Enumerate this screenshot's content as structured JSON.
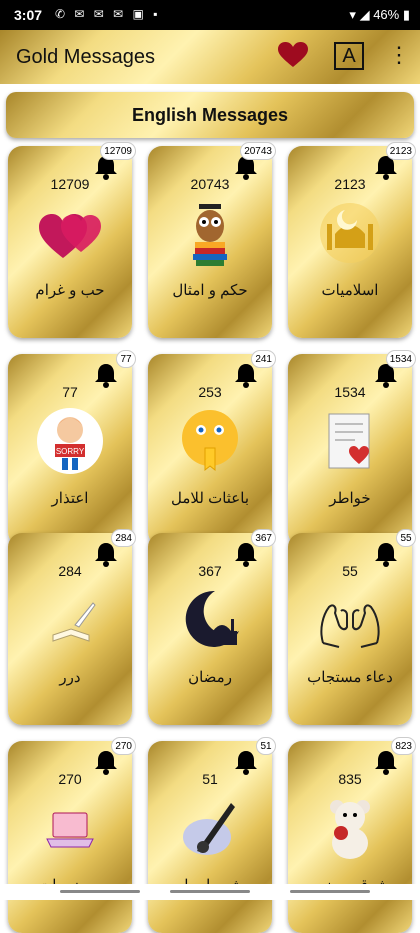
{
  "status_bar": {
    "time": "3:07",
    "battery": "46%",
    "left_icons": "✆ ✉ ✉ ✉ ▣ ▪"
  },
  "app_bar": {
    "title": "Gold Messages",
    "font_button": "A",
    "menu": "⋮"
  },
  "english_button": "English Messages",
  "colors": {
    "gold_light": "#fff2b0",
    "gold_dark": "#a8862a",
    "heart": "#9e0b1f"
  },
  "cards": [
    {
      "label": "حب و غرام",
      "count": "12709",
      "badge": "12709",
      "icon": "two-hearts-icon"
    },
    {
      "label": "حكم و امثال",
      "count": "20743",
      "badge": "20743",
      "icon": "owl-books-icon"
    },
    {
      "label": "اسلاميات",
      "count": "2123",
      "badge": "2123",
      "icon": "mosque-icon"
    },
    {
      "label": "اعتذار",
      "count": "77",
      "badge": "77",
      "icon": "sorry-boy-icon"
    },
    {
      "label": "باعثات للامل",
      "count": "253",
      "badge": "241",
      "icon": "praying-emoji-icon"
    },
    {
      "label": "خواطر",
      "count": "1534",
      "badge": "1534",
      "icon": "letter-heart-icon"
    },
    {
      "label": "درر",
      "count": "284",
      "badge": "284",
      "icon": "book-quill-icon"
    },
    {
      "label": "رمضان",
      "count": "367",
      "badge": "367",
      "icon": "crescent-moon-icon"
    },
    {
      "label": "دعاء مستجاب",
      "count": "55",
      "badge": "55",
      "icon": "praying-hands-icon"
    },
    {
      "label": "رومنسيات",
      "count": "270",
      "badge": "270",
      "icon": "laptop-icon"
    },
    {
      "label": "شعر اصيل",
      "count": "51",
      "badge": "51",
      "icon": "quill-pen-icon"
    },
    {
      "label": "شوق و حنين",
      "count": "835",
      "badge": "823",
      "icon": "teddy-bear-rose-icon"
    }
  ]
}
